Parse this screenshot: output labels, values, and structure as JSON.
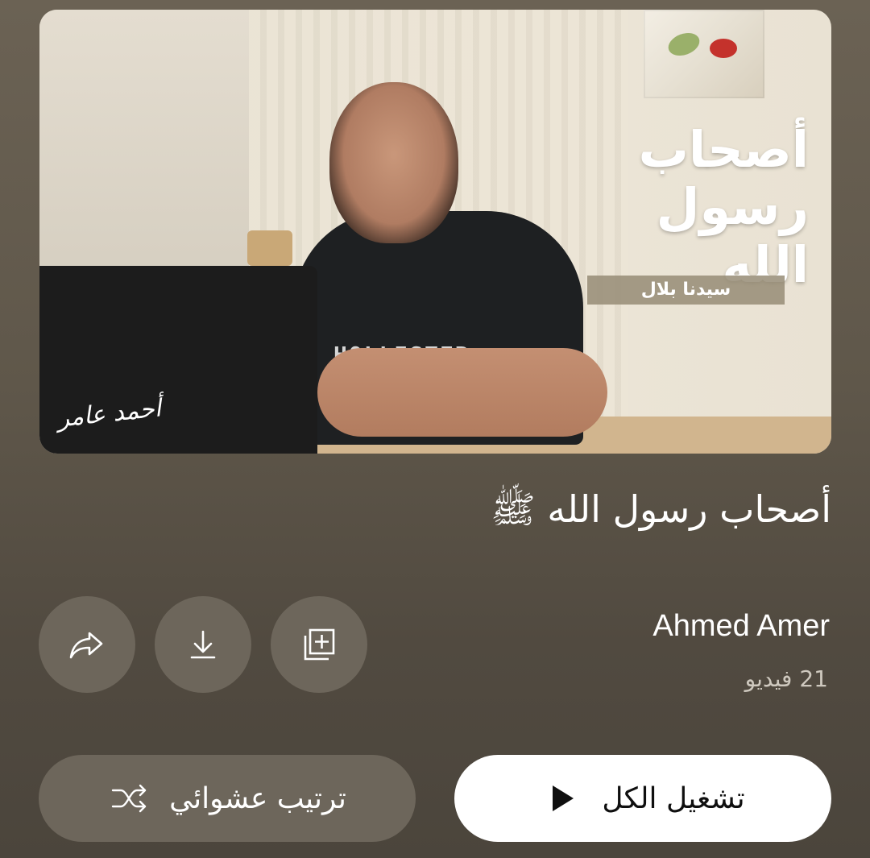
{
  "thumbnail": {
    "overlay_title_line1": "أصحاب",
    "overlay_title_line2": "رسول الله",
    "overlay_subtitle": "سيدنا بلال",
    "shirt_text": "HOLLISTER",
    "signature_text": "أحمد عامر"
  },
  "playlist": {
    "title": "أصحاب رسول الله ﷺ",
    "channel": "Ahmed Amer",
    "video_count": "21 فيديو"
  },
  "actions": {
    "share_icon": "share-icon",
    "download_icon": "download-icon",
    "save_icon": "add-to-playlist-icon"
  },
  "buttons": {
    "play_all_label": "تشغيل الكل",
    "shuffle_label": "ترتيب عشوائي"
  },
  "colors": {
    "background_top": "#6b6254",
    "background_bottom": "#4b453c",
    "round_button": "#6d665b",
    "play_button": "#ffffff",
    "play_text": "#0f0f0f",
    "secondary_text": "#cfc9bf"
  }
}
